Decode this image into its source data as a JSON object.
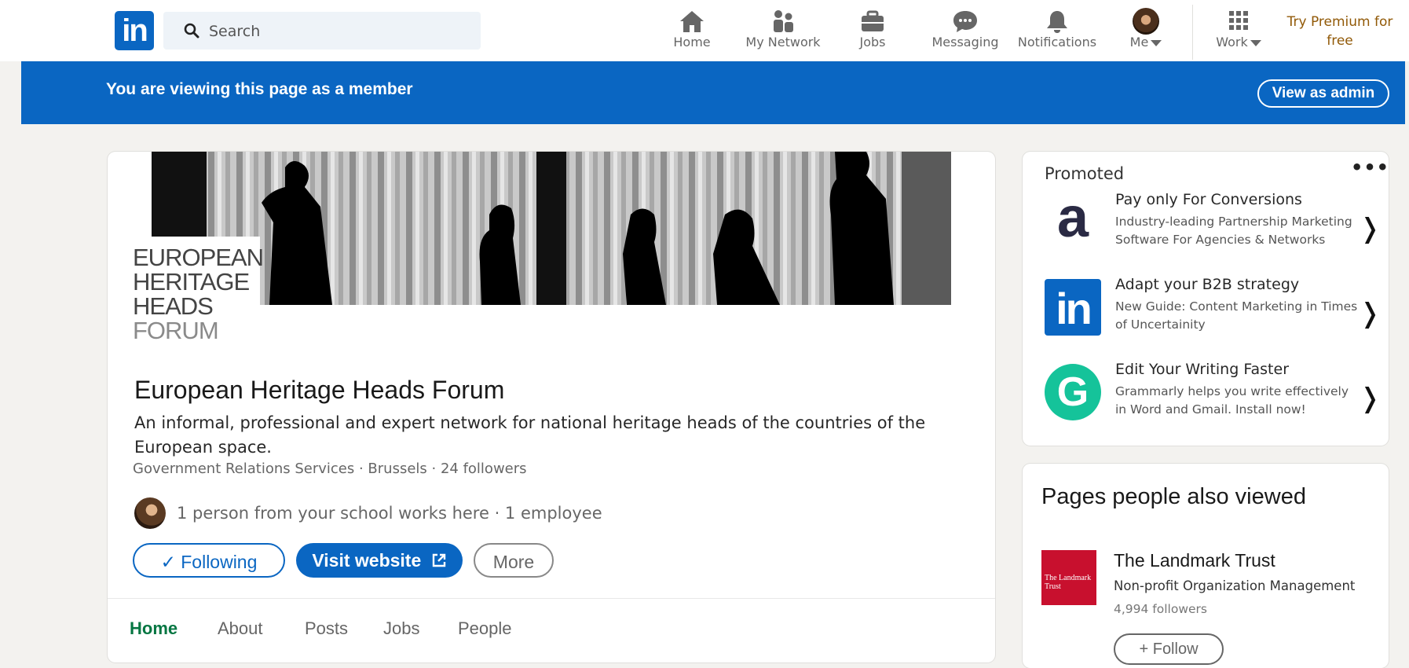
{
  "nav": {
    "search_placeholder": "Search",
    "items": [
      {
        "label": "Home",
        "icon": "home-icon"
      },
      {
        "label": "My Network",
        "icon": "network-icon"
      },
      {
        "label": "Jobs",
        "icon": "briefcase-icon"
      },
      {
        "label": "Messaging",
        "icon": "messaging-icon"
      },
      {
        "label": "Notifications",
        "icon": "bell-icon"
      },
      {
        "label": "Me",
        "icon": "avatar"
      },
      {
        "label": "Work",
        "icon": "grid-icon"
      }
    ],
    "premium": "Try Premium for free"
  },
  "banner": {
    "message": "You are viewing this page as a member",
    "admin_button": "View as admin"
  },
  "org": {
    "logo_lines": [
      "EUROPEAN",
      "HERITAGE",
      "HEADS",
      "FORUM"
    ],
    "name": "European Heritage Heads Forum",
    "tagline": "An informal, professional and expert network for national heritage heads of the countries of the European space.",
    "meta": "Government Relations Services · Brussels · 24 followers",
    "employees": "1 person from your school works here · 1 employee",
    "buttons": {
      "following": "✓ Following",
      "visit": "Visit website",
      "more": "More"
    },
    "tabs": [
      "Home",
      "About",
      "Posts",
      "Jobs",
      "People"
    ],
    "active_tab": "Home"
  },
  "promoted": {
    "title": "Promoted",
    "menu": "•••",
    "ads": [
      {
        "title": "Pay only For Conversions",
        "desc": "Industry-leading Partnership Marketing Software For Agencies & Networks",
        "logo_text": "a"
      },
      {
        "title": "Adapt your B2B strategy",
        "desc": "New Guide: Content Marketing in Times of Uncertainity",
        "logo_text": "in"
      },
      {
        "title": "Edit Your Writing Faster",
        "desc": "Grammarly helps you write effectively in Word and Gmail. Install now!",
        "logo_text": "G"
      }
    ]
  },
  "pages_viewed": {
    "title": "Pages people also viewed",
    "items": [
      {
        "logo_text": "The Landmark Trust",
        "name": "The Landmark Trust",
        "industry": "Non-profit Organization Management",
        "followers": "4,994 followers",
        "button": "+ Follow"
      }
    ]
  },
  "colors": {
    "brand_blue": "#0a66c2",
    "active_tab_green": "#057642",
    "premium_gold": "#915907",
    "landmark_red": "#c8102e",
    "grammarly_green": "#15c39a"
  }
}
